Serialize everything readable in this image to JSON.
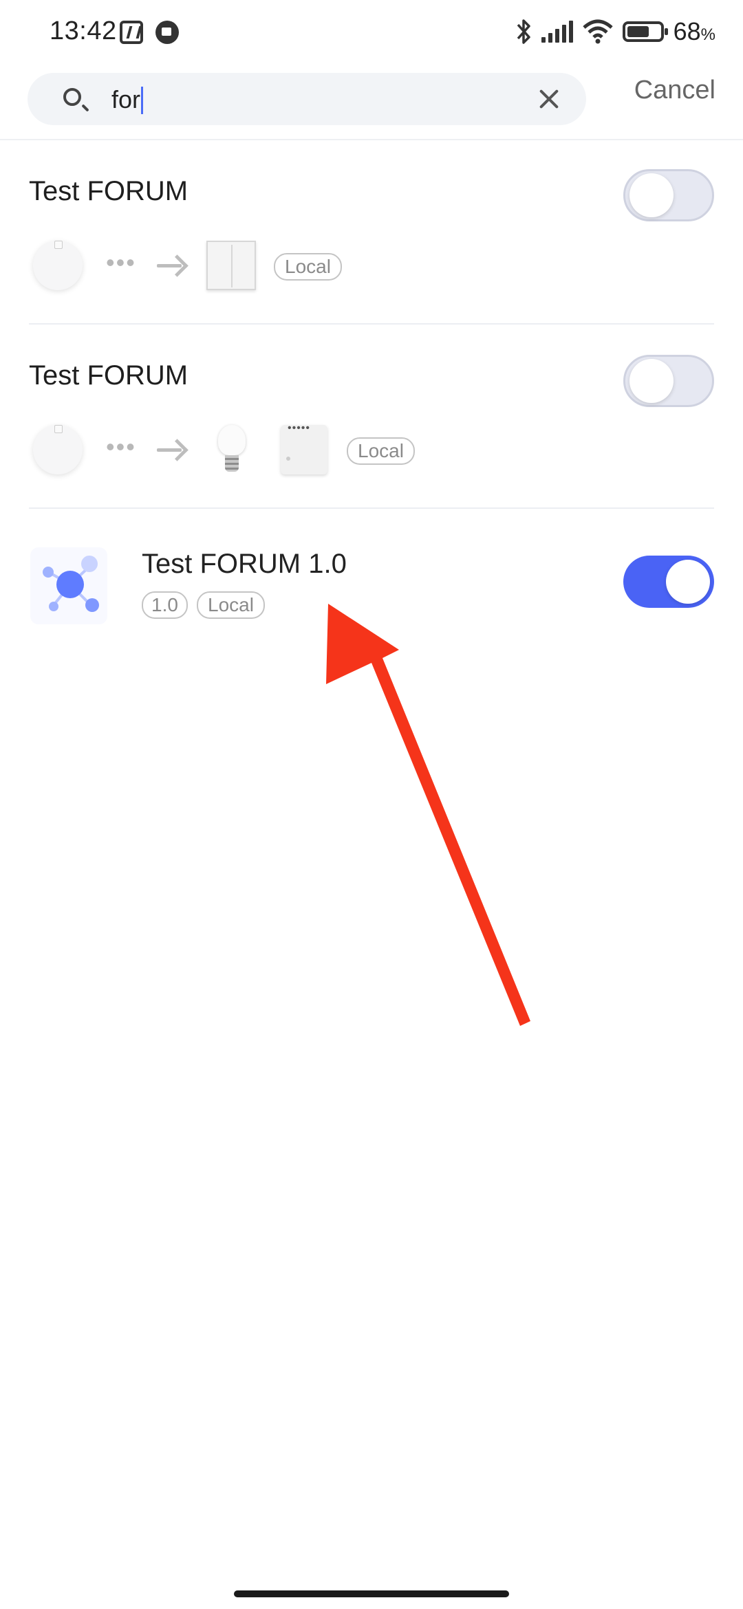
{
  "status_bar": {
    "time": "13:42",
    "battery_percent": "68",
    "battery_unit": "%",
    "battery_level": 0.68,
    "icons": [
      "nfc-icon",
      "notification-icon",
      "bluetooth-icon",
      "signal-icon",
      "wifi-icon",
      "battery-icon"
    ]
  },
  "search": {
    "value": "for",
    "cancel_label": "Cancel"
  },
  "results": [
    {
      "title": "Test FORUM",
      "enabled": false,
      "tag": "Local",
      "devices": [
        "hub-device",
        "more-dots",
        "arrow-right",
        "wall-switch"
      ]
    },
    {
      "title": "Test FORUM",
      "enabled": false,
      "tag": "Local",
      "devices": [
        "hub-device",
        "more-dots",
        "arrow-right",
        "light-bulb",
        "relay-module"
      ]
    },
    {
      "title": "Test FORUM 1.0",
      "enabled": true,
      "version_tag": "1.0",
      "tag": "Local",
      "icon": "molecule-scene-icon"
    }
  ],
  "colors": {
    "accent": "#4a63f5",
    "annotation_arrow": "#f5341a",
    "toggle_off": "#e6e8f2"
  }
}
